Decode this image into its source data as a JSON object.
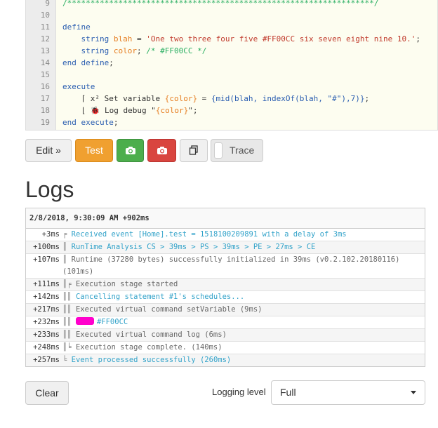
{
  "editor": {
    "lines": [
      {
        "n": "9",
        "parts": [
          {
            "c": "cm",
            "t": "/******************************************************************/"
          }
        ]
      },
      {
        "n": "10",
        "parts": []
      },
      {
        "n": "11",
        "parts": [
          {
            "c": "kw",
            "t": "define"
          }
        ]
      },
      {
        "n": "12",
        "parts": [
          {
            "c": "plain",
            "t": "    "
          },
          {
            "c": "kw",
            "t": "string"
          },
          {
            "c": "plain",
            "t": " "
          },
          {
            "c": "var",
            "t": "blah"
          },
          {
            "c": "plain",
            "t": " = "
          },
          {
            "c": "str",
            "t": "'One two three four five #FF00CC six seven eight nine 10.'"
          },
          {
            "c": "plain",
            "t": ";"
          }
        ]
      },
      {
        "n": "13",
        "parts": [
          {
            "c": "plain",
            "t": "    "
          },
          {
            "c": "kw",
            "t": "string"
          },
          {
            "c": "plain",
            "t": " "
          },
          {
            "c": "var",
            "t": "color"
          },
          {
            "c": "plain",
            "t": "; "
          },
          {
            "c": "cm",
            "t": "/* #FF00CC */"
          }
        ]
      },
      {
        "n": "14",
        "parts": [
          {
            "c": "kw",
            "t": "end define"
          },
          {
            "c": "plain",
            "t": ";"
          }
        ]
      },
      {
        "n": "15",
        "parts": []
      },
      {
        "n": "16",
        "parts": [
          {
            "c": "kw",
            "t": "execute"
          }
        ]
      },
      {
        "n": "17",
        "parts": [
          {
            "c": "plain",
            "t": "    ⌈ x² Set variable "
          },
          {
            "c": "var",
            "t": "{color}"
          },
          {
            "c": "plain",
            "t": " = "
          },
          {
            "c": "kw",
            "t": "{mid(blah, indexOf(blah, \"#\"),7)}"
          },
          {
            "c": "plain",
            "t": ";"
          }
        ]
      },
      {
        "n": "18",
        "parts": [
          {
            "c": "plain",
            "t": "    ⌊ 🐞 Log debug \""
          },
          {
            "c": "var",
            "t": "{color}"
          },
          {
            "c": "plain",
            "t": "\";"
          }
        ]
      },
      {
        "n": "19",
        "parts": [
          {
            "c": "kw",
            "t": "end execute"
          },
          {
            "c": "plain",
            "t": ";"
          }
        ]
      }
    ]
  },
  "toolbar": {
    "edit_label": "Edit »",
    "test_label": "Test",
    "trace_label": "Trace"
  },
  "logs": {
    "title": "Logs",
    "header": "2/8/2018, 9:30:09 AM +902ms",
    "rows": [
      {
        "time": "+3ms",
        "tree": "╒",
        "cls": "info",
        "msg": "Received event [Home].test = 1518100209891 with a delay of 3ms"
      },
      {
        "time": "+100ms",
        "tree": "║",
        "cls": "info",
        "msg": "RunTime Analysis CS > 39ms > PS > 39ms > PE > 27ms > CE"
      },
      {
        "time": "+107ms",
        "tree": "║",
        "cls": "plainlog",
        "msg": "Runtime (37280 bytes) successfully initialized in 39ms (v0.2.102.20180116) (101ms)"
      },
      {
        "time": "+111ms",
        "tree": "║╒",
        "cls": "plainlog",
        "msg": "Execution stage started"
      },
      {
        "time": "+142ms",
        "tree": "║║",
        "cls": "info",
        "msg": "Cancelling statement #1's schedules..."
      },
      {
        "time": "+217ms",
        "tree": "║║",
        "cls": "plainlog",
        "msg": "Executed virtual command setVariable (9ms)"
      },
      {
        "time": "+232ms",
        "tree": "║║",
        "cls": "info",
        "msg": "#FF00CC",
        "swatch": true
      },
      {
        "time": "+233ms",
        "tree": "║║",
        "cls": "plainlog",
        "msg": "Executed virtual command log (6ms)"
      },
      {
        "time": "+248ms",
        "tree": "║╘",
        "cls": "plainlog",
        "msg": "Execution stage complete. (140ms)"
      },
      {
        "time": "+257ms",
        "tree": "╘",
        "cls": "info",
        "msg": "Event processed successfully (260ms)"
      }
    ]
  },
  "footer": {
    "clear_label": "Clear",
    "logging_level_label": "Logging level",
    "logging_level_value": "Full"
  },
  "colors": {
    "swatch": "#FF00CC",
    "test_button": "#f0a030",
    "camera_green": "#4cae4c",
    "camera_red": "#d9453f"
  },
  "icons": {
    "camera": "camera-icon",
    "copy": "copy-icon"
  }
}
